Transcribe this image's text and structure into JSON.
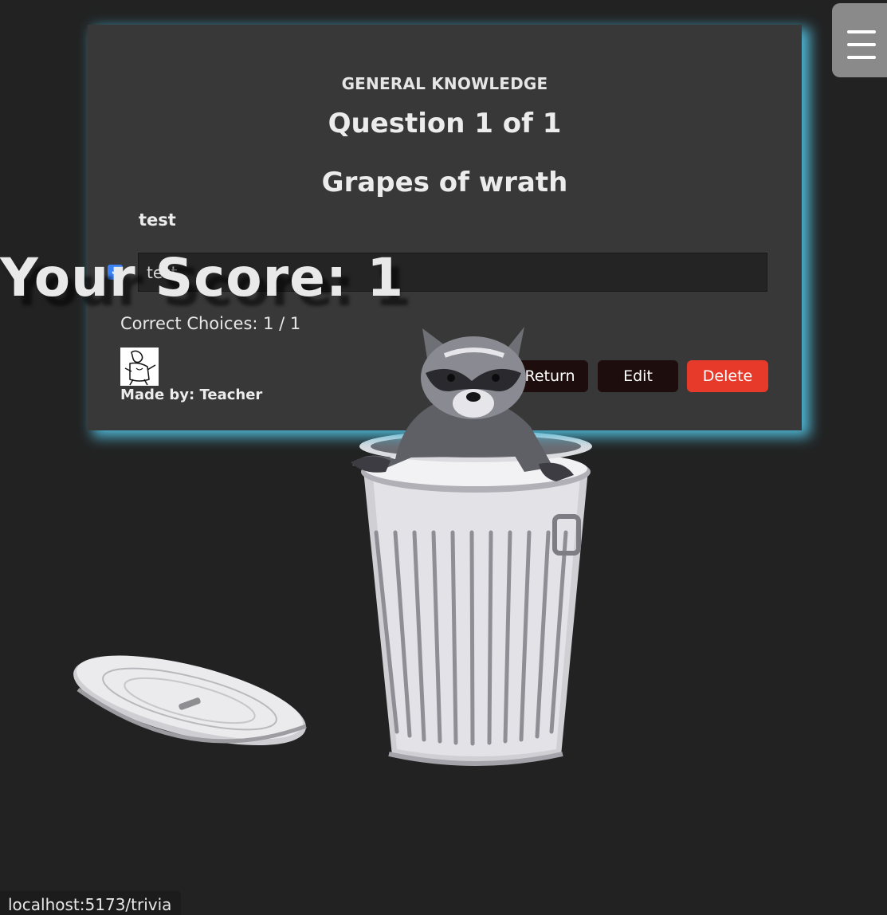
{
  "quiz": {
    "category": "GENERAL KNOWLEDGE",
    "question_counter": "Question 1 of 1",
    "question_title": "Grapes of wrath",
    "prompt": "test",
    "answer_value": "test",
    "correct_choices": "Correct Choices: 1 / 1",
    "made_by": "Made by: Teacher"
  },
  "buttons": {
    "return": "Return",
    "edit": "Edit",
    "delete": "Delete"
  },
  "score_banner": "Your Score: 1",
  "status_bar": {
    "url": "localhost:5173/trivia"
  },
  "icons": {
    "menu": "hamburger-menu-icon",
    "checkbox": "checkbox-checked-icon"
  },
  "colors": {
    "card_glow": "#4fb8d6",
    "delete": "#e83a2a",
    "checkbox": "#3b82f6"
  }
}
